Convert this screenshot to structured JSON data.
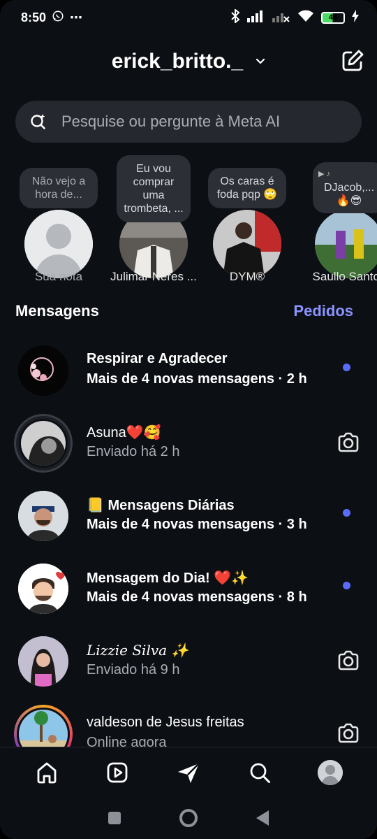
{
  "status_bar": {
    "time": "8:50",
    "battery": "48",
    "more": "⋯"
  },
  "header": {
    "username": "erick_britto._"
  },
  "search": {
    "placeholder": "Pesquise ou pergunte à Meta AI"
  },
  "notes": [
    {
      "note": "Não vejo a hora de...",
      "name": "Sua nota"
    },
    {
      "note": "Eu vou comprar uma trombeta, ...",
      "name": "Julimar Neres ..."
    },
    {
      "note": "Os caras é foda pqp 🙄",
      "name": "DYM®"
    },
    {
      "note": "DJacob,...🔥😎",
      "name": "Saullo Santos"
    }
  ],
  "section": {
    "title": "Mensagens",
    "requests": "Pedidos"
  },
  "conversations": [
    {
      "name": "Respirar e Agradecer",
      "subtitle": "Mais de 4 novas mensagens · 2 h",
      "unread": true
    },
    {
      "name": "Asuna❤️🥰",
      "subtitle": "Enviado há 2 h",
      "unread": false
    },
    {
      "name": "📒 Mensagens Diárias",
      "subtitle": "Mais de 4 novas mensagens · 3 h",
      "unread": true
    },
    {
      "name": "Mensagem do Dia! ❤️✨",
      "subtitle": "Mais de 4 novas mensagens · 8 h",
      "unread": true
    },
    {
      "name": "Lizzie Silva ✨",
      "subtitle": "Enviado há 9 h",
      "unread": false
    },
    {
      "name": "valdeson de Jesus freitas",
      "subtitle": "Online agora",
      "unread": false
    }
  ],
  "colors": {
    "accent": "#8b93ff",
    "unread_dot": "#5b6bff",
    "background": "#0c0f14"
  },
  "bottom_nav": [
    "home-icon",
    "reels-icon",
    "direct-icon",
    "search-icon",
    "profile-avatar"
  ]
}
